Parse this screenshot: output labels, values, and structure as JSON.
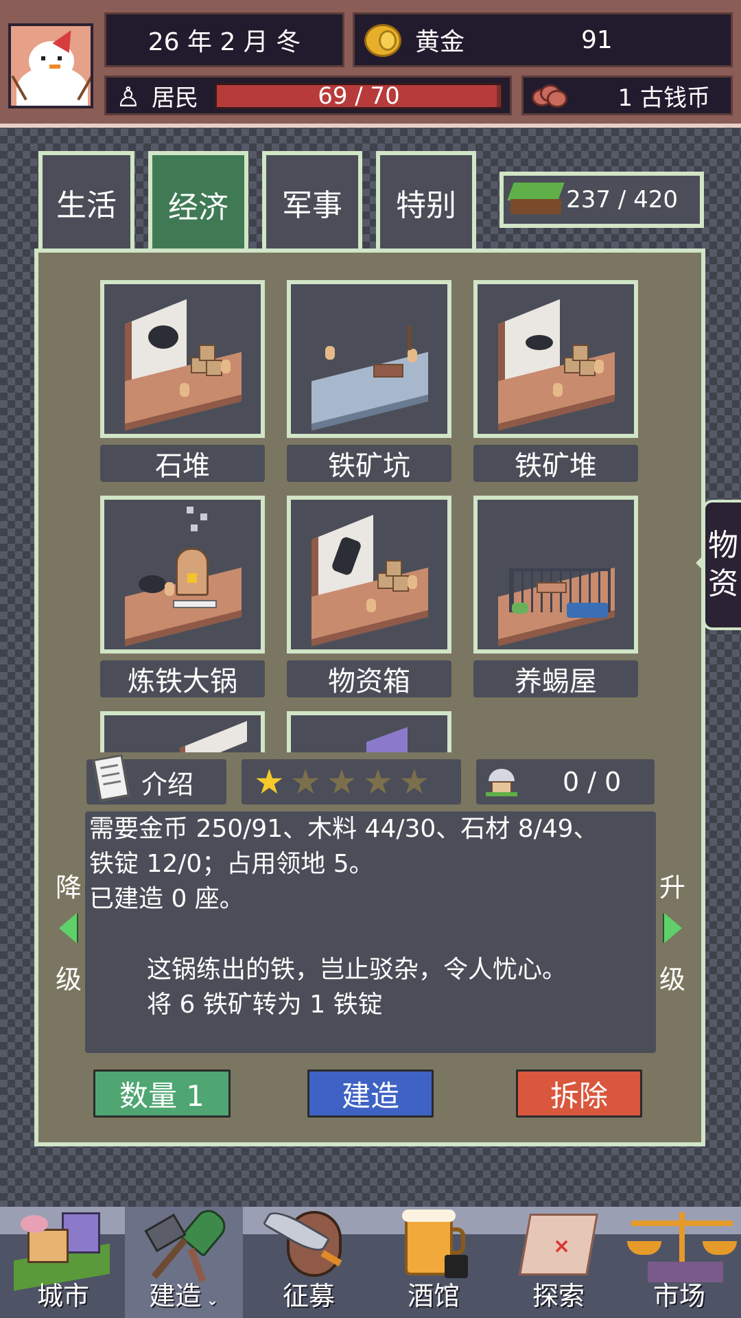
{
  "hud": {
    "date": "26 年 2 月 冬",
    "gold_label": "黄金",
    "gold_value": "91",
    "residents_label": "居民",
    "residents_text": "69 / 70",
    "residents_fraction": 0.9857,
    "ancient_coins": "1 古钱币",
    "avatar_icon": "snowman-avatar",
    "gold_icon": "gold-coin-icon",
    "ancient_coin_icon": "ancient-coins-icon",
    "resident_icon": "person-icon"
  },
  "tabs": [
    {
      "label": "生活",
      "active": false
    },
    {
      "label": "经济",
      "active": true
    },
    {
      "label": "军事",
      "active": false
    },
    {
      "label": "特别",
      "active": false
    }
  ],
  "land": {
    "text": "237 / 420",
    "icon": "grass-block-icon"
  },
  "buildings": [
    {
      "name": "石堆",
      "icon": "stone-pile-icon"
    },
    {
      "name": "铁矿坑",
      "icon": "iron-mine-pit-icon"
    },
    {
      "name": "铁矿堆",
      "icon": "iron-ore-pile-icon"
    },
    {
      "name": "炼铁大锅",
      "icon": "iron-smelter-icon"
    },
    {
      "name": "物资箱",
      "icon": "supply-crate-icon"
    },
    {
      "name": "养蜴屋",
      "icon": "lizard-house-icon"
    }
  ],
  "side_tab": {
    "line1": "物",
    "line2": "资"
  },
  "info": {
    "intro_label": "介绍",
    "stars_total": 5,
    "stars_filled": 1,
    "owned": "0 / 0",
    "desc_line1": "需要金币 250/91、木料 44/30、石材 8/49、",
    "desc_line2": "铁锭 12/0；占用领地 5。",
    "desc_line3": "已建造 0 座。",
    "quote_line1": "这锅练出的铁，岂止驳杂，令人忧心。",
    "quote_line2": "将 6 铁矿转为 1 铁锭",
    "downgrade_top": "降",
    "downgrade_bottom": "级",
    "upgrade_top": "升",
    "upgrade_bottom": "级"
  },
  "actions": {
    "quantity": "数量 1",
    "build": "建造",
    "demolish": "拆除",
    "quantity_color": "#4fa672",
    "build_color": "#3f63c4",
    "demolish_color": "#d9573c"
  },
  "nav": [
    {
      "label": "城市",
      "icon": "city-icon",
      "active": false
    },
    {
      "label": "建造",
      "icon": "build-shovel-icon",
      "active": true
    },
    {
      "label": "征募",
      "icon": "recruit-sword-shield-icon",
      "active": false
    },
    {
      "label": "酒馆",
      "icon": "tavern-beer-icon",
      "active": false
    },
    {
      "label": "探索",
      "icon": "explore-map-icon",
      "active": false
    },
    {
      "label": "市场",
      "icon": "market-scale-icon",
      "active": false
    }
  ]
}
